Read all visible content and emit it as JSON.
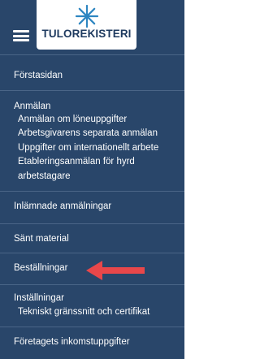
{
  "header": {
    "logo_text": "TULOREKISTERI"
  },
  "menu": {
    "home": "Förstasidan",
    "reports": "Anmälan",
    "reports_sub": [
      "Anmälan om löneuppgifter",
      "Arbetsgivarens separata anmälan",
      "Uppgifter om internationellt arbete",
      "Etableringsanmälan för hyrd",
      "arbetstagare"
    ],
    "submitted": "Inlämnade anmälningar",
    "sent_material": "Sänt material",
    "orders": "Beställningar",
    "settings": "Inställningar",
    "settings_sub": [
      "Tekniskt gränssnitt och certifikat"
    ],
    "company_income": "Företagets inkomstuppgifter"
  },
  "colors": {
    "sidebar_bg": "#29466a",
    "divider": "#4a6587",
    "arrow": "#e8474a",
    "logo_blue": "#1e3a5f",
    "logo_star": "#2e86c1"
  },
  "icons": {
    "menu": "hamburger-icon",
    "logo": "star-burst-icon",
    "annotation": "arrow-left-icon"
  }
}
